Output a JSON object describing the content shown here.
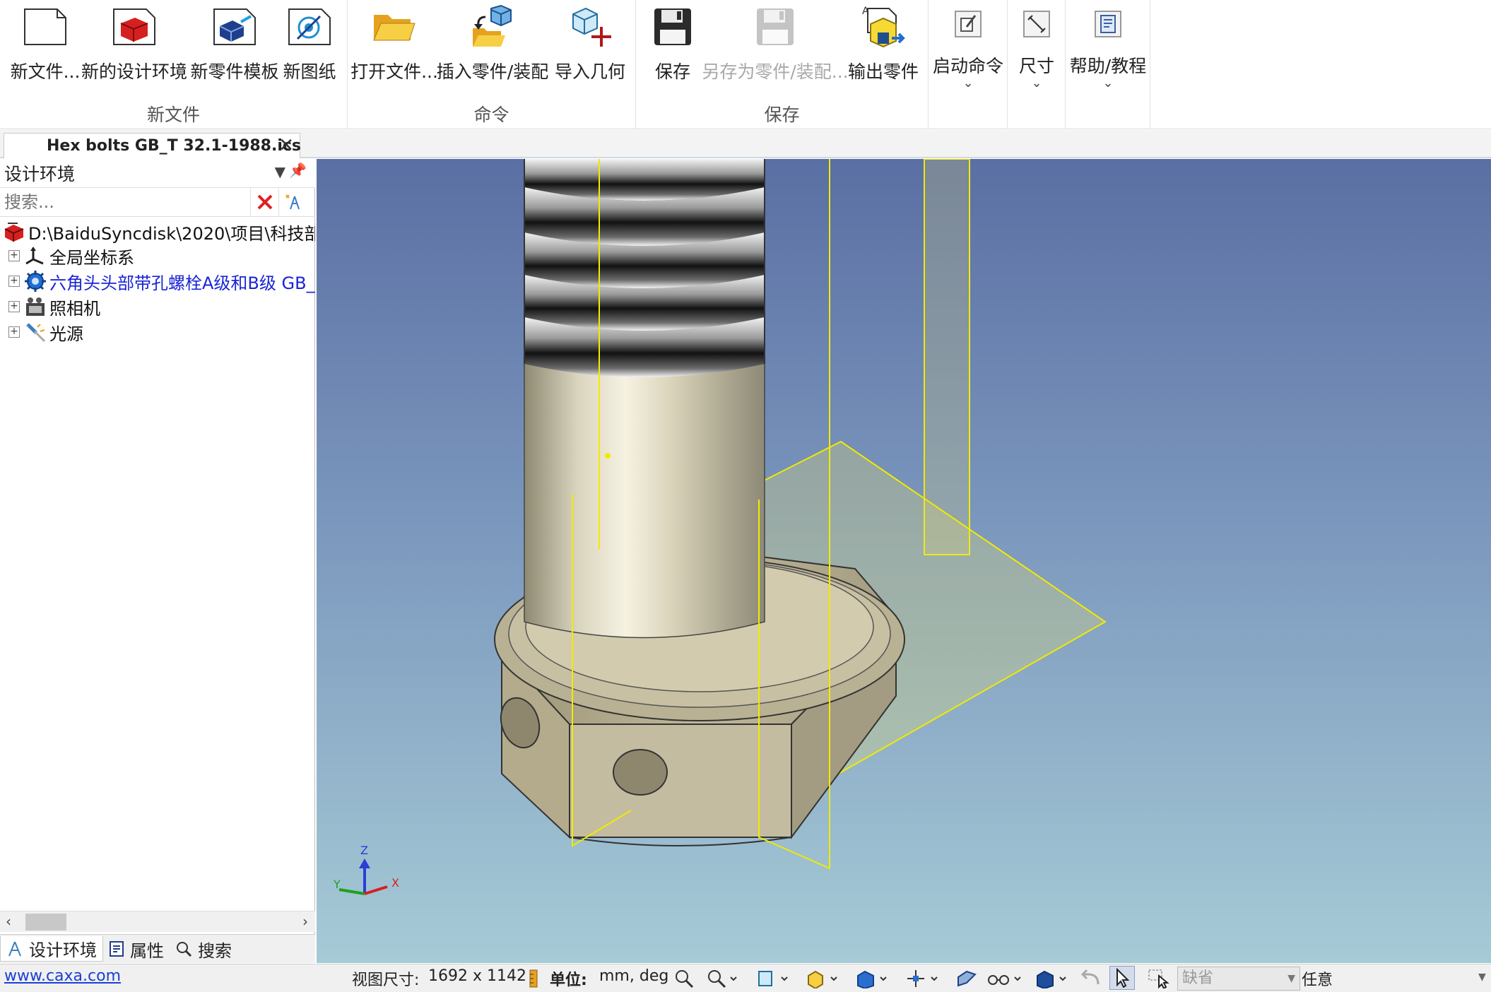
{
  "ribbon": {
    "groups": [
      {
        "title": "新文件",
        "buttons": [
          {
            "label": "新文件...",
            "icon": "blank-page-icon"
          },
          {
            "label": "新的设计环境",
            "icon": "design-environment-icon"
          },
          {
            "label": "新零件模板",
            "icon": "part-template-icon"
          },
          {
            "label": "新图纸",
            "icon": "drawing-icon"
          }
        ]
      },
      {
        "title": "命令",
        "buttons": [
          {
            "label": "打开文件...",
            "icon": "folder-open-icon"
          },
          {
            "label": "插入零件/装配",
            "icon": "insert-part-icon"
          },
          {
            "label": "导入几何",
            "icon": "import-geometry-icon"
          }
        ]
      },
      {
        "title": "保存",
        "buttons": [
          {
            "label": "保存",
            "icon": "save-icon"
          },
          {
            "label": "另存为零件/装配...",
            "icon": "save-as-icon",
            "disabled": true
          },
          {
            "label": "输出零件",
            "icon": "export-part-icon"
          }
        ]
      },
      {
        "title": "",
        "buttons": [
          {
            "label": "启动命令",
            "icon": "start-command-icon",
            "dropdown": true
          }
        ]
      },
      {
        "title": "",
        "buttons": [
          {
            "label": "尺寸",
            "icon": "dimension-icon",
            "dropdown": true
          }
        ]
      },
      {
        "title": "",
        "buttons": [
          {
            "label": "帮助/教程",
            "icon": "help-icon",
            "dropdown": true
          }
        ]
      }
    ]
  },
  "document_tab": {
    "title": "Hex bolts GB_T 32.1-1988.ics",
    "close_icon": "close-icon"
  },
  "panel": {
    "title": "设计环境",
    "search_placeholder": "搜索...",
    "tree": [
      {
        "label": "D:\\BaiduSyncdisk\\2020\\项目\\科技部",
        "icon": "design-environment-icon",
        "root": true
      },
      {
        "label": "全局坐标系",
        "icon": "coordinate-system-icon"
      },
      {
        "label": "六角头头部带孔螺栓A级和B级 GB_",
        "icon": "gear-part-icon",
        "highlight": true
      },
      {
        "label": "照相机",
        "icon": "camera-icon"
      },
      {
        "label": "光源",
        "icon": "light-source-icon"
      }
    ],
    "bottom_tabs": [
      {
        "label": "设计环境",
        "icon": "tree-icon",
        "active": true
      },
      {
        "label": "属性",
        "icon": "properties-icon"
      },
      {
        "label": "搜索",
        "icon": "search-icon"
      }
    ]
  },
  "viewport": {
    "axis_labels": {
      "z": "Z",
      "y": "Y",
      "x": "X"
    },
    "background_top": "#5a6fa3",
    "background_bottom": "#a6cbd6",
    "highlight_color": "#f2ea00"
  },
  "status": {
    "link": "www.caxa.com",
    "view_size_label": "视图尺寸:",
    "view_size_value": "1692 x 1142",
    "unit_label": "单位:",
    "unit_value": "mm, deg",
    "combo_value": "缺省",
    "mode_value": "任意"
  },
  "colors": {
    "accent_red": "#d62020",
    "link_blue": "#1a3fd6",
    "tree_blue": "#1a24d6"
  }
}
